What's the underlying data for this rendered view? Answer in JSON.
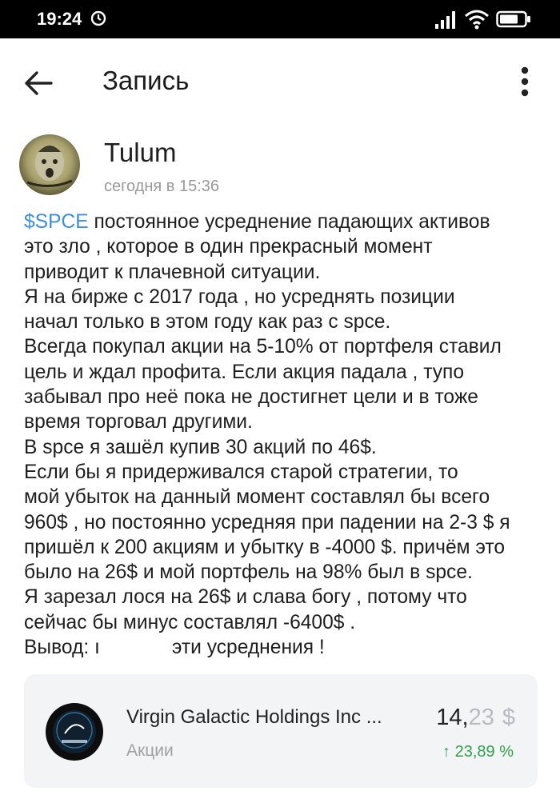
{
  "status_bar": {
    "time": "19:24"
  },
  "app_bar": {
    "title": "Запись"
  },
  "post": {
    "author": "Tulum",
    "timestamp": "сегодня в 15:36",
    "ticker": "$SPCE",
    "first_line_rest": " постоянное усреднение падающих активов",
    "lines": [
      "это зло , которое в один прекрасный момент",
      "приводит к плачевной ситуации.",
      "Я на бирже с 2017 года , но усреднять позиции",
      "начал только в этом году как раз с spce.",
      "Всегда покупал акции на 5-10% от портфеля ставил",
      "цель и ждал профита. Если акция падала , тупо",
      "забывал про неё пока не достигнет цели и в тоже",
      "время торговал другими.",
      "В spce я зашёл купив 30 акций по 46$.",
      "Если бы я придерживался старой стратегии, то",
      "мой убыток на данный момент составлял бы всего",
      "960$ , но постоянно усредняя при падении на 2-3 $ я",
      "пришёл к 200 акциям и убытку в -4000 $. причём это",
      "было на 26$ и мой портфель на 98% был в spce.",
      "Я зарезал лося на 26$ и слава богу , потому что",
      "сейчас бы минус составлял -6400$ ."
    ],
    "last_line_start": "Вывод: ı",
    "last_line_end": "эти усреднения !"
  },
  "instrument_card": {
    "name": "Virgin Galactic Holdings Inc ...",
    "type": "Акции",
    "price_int": "14,",
    "price_frac": "23",
    "currency": "$",
    "change": "23,89 %",
    "change_color": "#2fa14a"
  },
  "colors": {
    "ticker": "#3c8ee0",
    "card_bg": "#f3f4f6"
  }
}
